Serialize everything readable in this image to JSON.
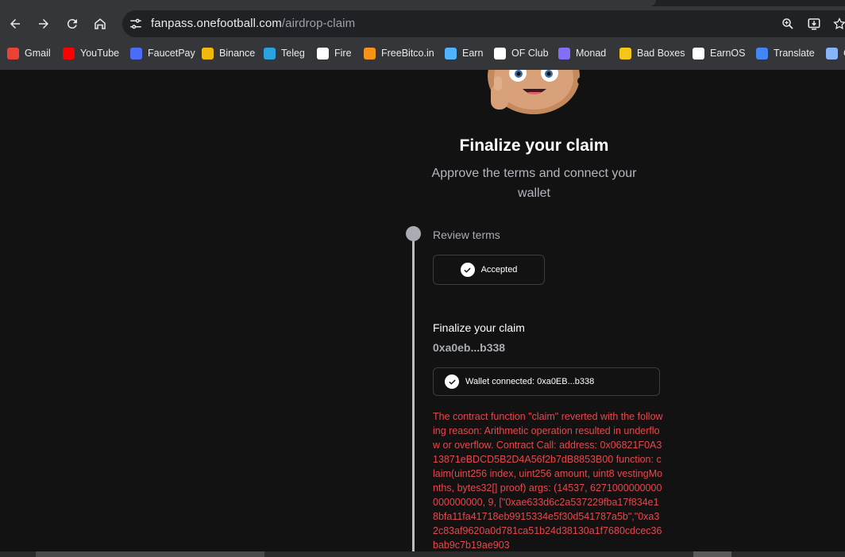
{
  "browser": {
    "url_host": "fanpass.onefootball.com",
    "url_path": "/airdrop-claim",
    "bookmarks": [
      {
        "label": "Gmail",
        "icon": "gmail-icon",
        "color": "#ea4335"
      },
      {
        "label": "YouTube",
        "icon": "youtube-icon",
        "color": "#ff0000"
      },
      {
        "label": "FaucetPay",
        "icon": "faucetpay-icon",
        "color": "#4a6cf7"
      },
      {
        "label": "Binance",
        "icon": "binance-icon",
        "color": "#f0b90b"
      },
      {
        "label": "Teleg",
        "icon": "telegram-icon",
        "color": "#2aa3e0"
      },
      {
        "label": "Fire",
        "icon": "fire-icon",
        "color": "#ffffff"
      },
      {
        "label": "FreeBitco.in",
        "icon": "bitcoin-icon",
        "color": "#f7931a"
      },
      {
        "label": "Earn",
        "icon": "earn-icon",
        "color": "#4fb3ff"
      },
      {
        "label": "OF Club",
        "icon": "ofclub-icon",
        "color": "#ffffff"
      },
      {
        "label": "Monad",
        "icon": "monad-icon",
        "color": "#836ef9"
      },
      {
        "label": "Bad Boxes",
        "icon": "badboxes-icon",
        "color": "#f5c518"
      },
      {
        "label": "EarnOS",
        "icon": "earnos-icon",
        "color": "#ffffff"
      },
      {
        "label": "Translate",
        "icon": "translate-icon",
        "color": "#4285f4"
      },
      {
        "label": "C",
        "icon": "overflow-icon",
        "color": "#8ab4f8"
      }
    ]
  },
  "page": {
    "title": "Finalize your claim",
    "subtitle": "Approve the terms and connect your wallet",
    "step1_label": "Review terms",
    "accepted_label": "Accepted",
    "step2_label": "Finalize your claim",
    "wallet_address": "0xa0eb...b338",
    "wallet_status": "Wallet connected: 0xa0EB...b338",
    "error_message": "The contract function \"claim\" reverted with the following reason: Arithmetic operation resulted in underflow or overflow. Contract Call: address: 0x06821F0A313871eBDCD5B2D4A56f2b7dB8853B00 function: claim(uint256 index, uint256 amount, uint8 vestingMonths, bytes32[] proof) args: (14537, 6271000000000000000000, 9, [\"0xae633d6c2a537229fba17f834e18bfa11fa41718eb9915334e5f30d541787a5b\",\"0xa32c83af9620a0d781ca51b24d38130a1f7680cdcec36bab9c7b19ae903"
  }
}
